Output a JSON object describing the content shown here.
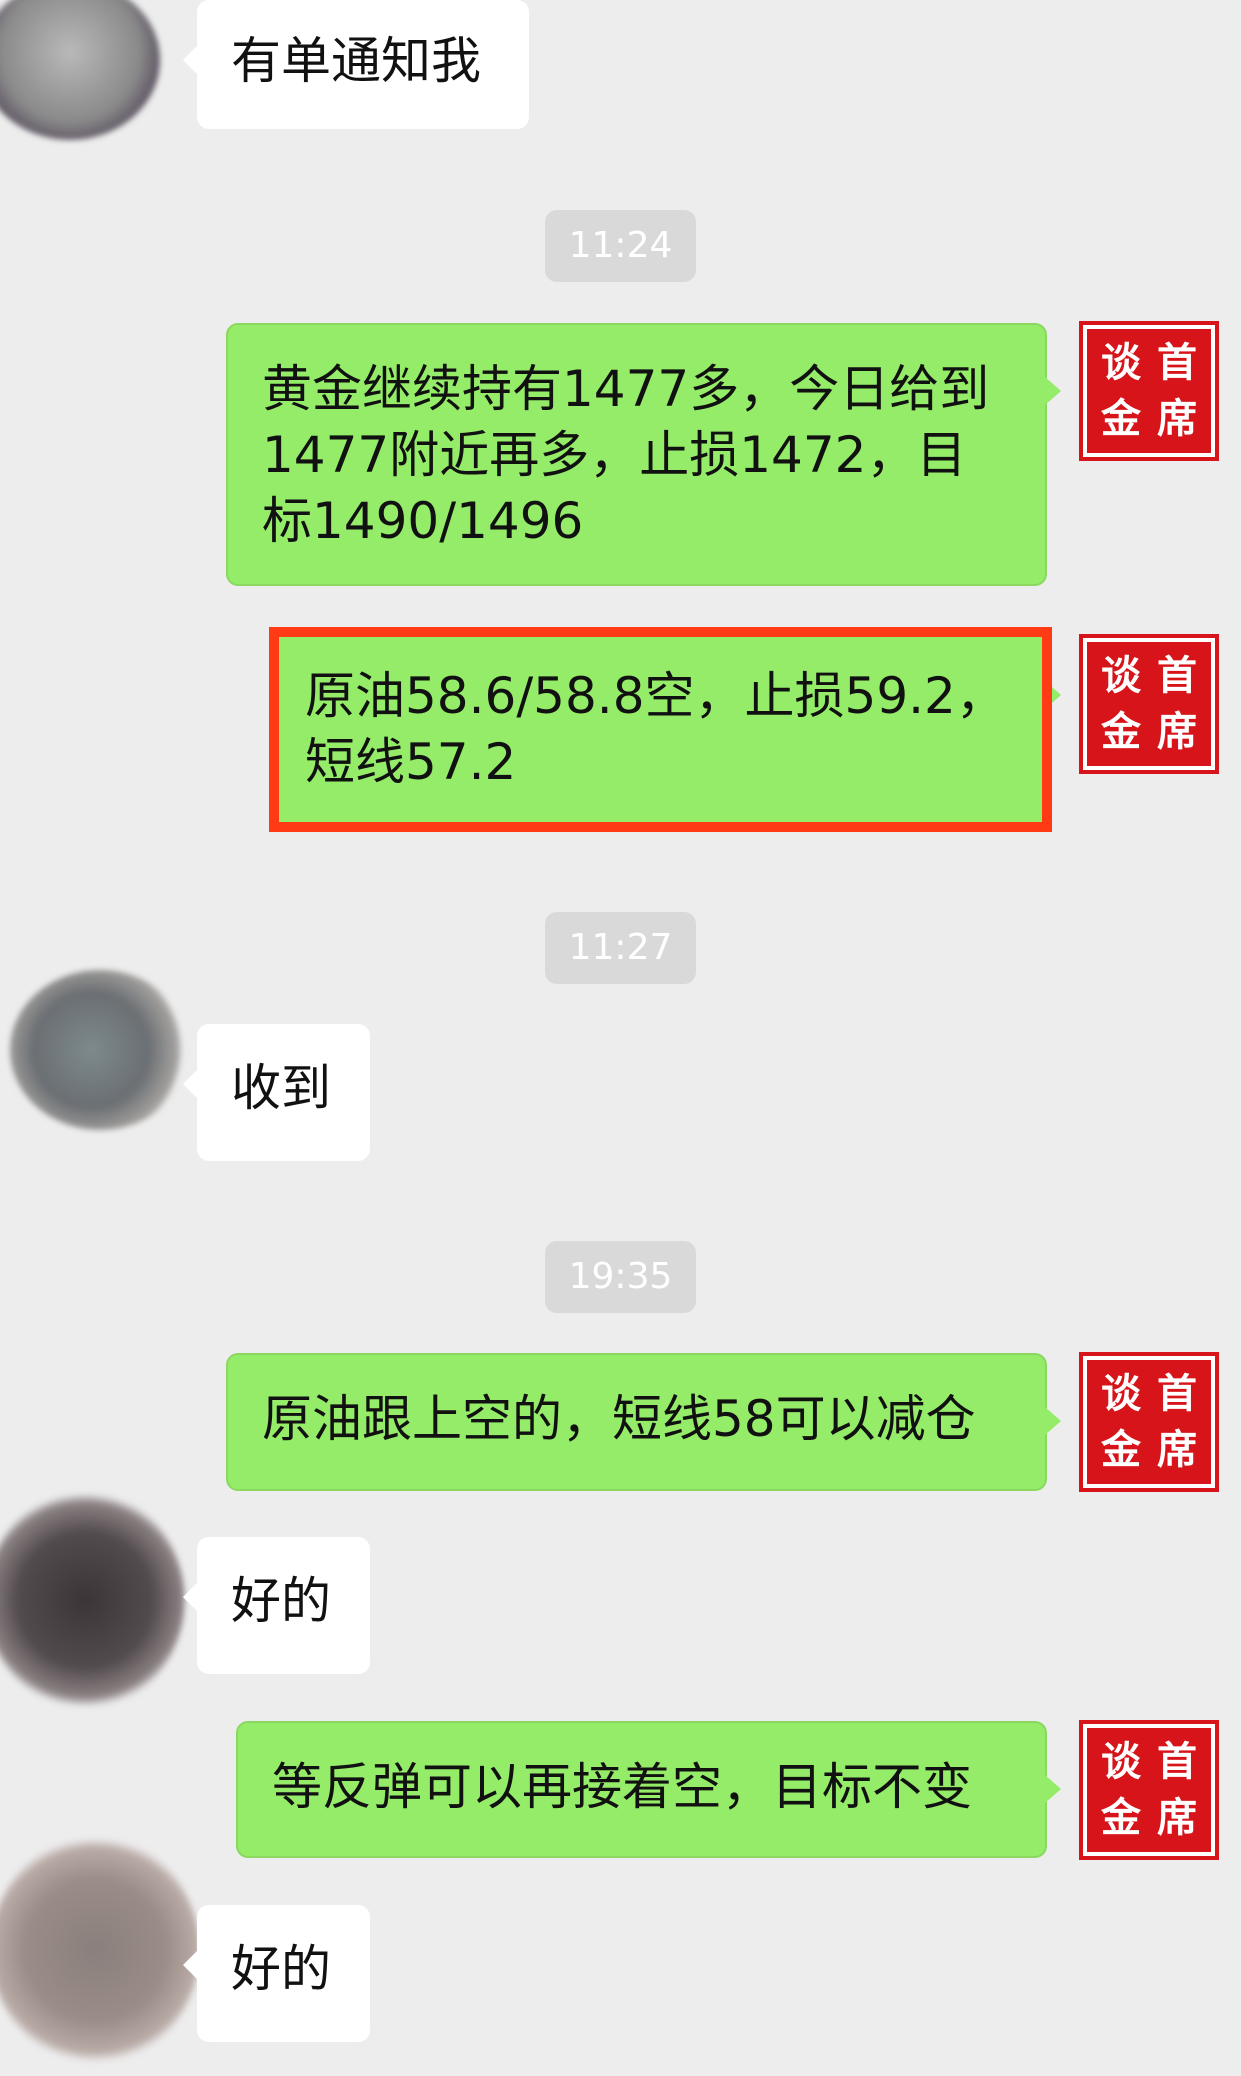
{
  "messages": [
    {
      "text": "有单通知我"
    },
    {
      "text": "11:24"
    },
    {
      "text": "黄金继续持有1477多，今日给到1477附近再多，止损1472，目标1490/1496"
    },
    {
      "text": "原油58.6/58.8空，止损59.2，短线57.2"
    },
    {
      "text": "11:27"
    },
    {
      "text": "收到"
    },
    {
      "text": "19:35"
    },
    {
      "text": "原油跟上空的，短线58可以减仓"
    },
    {
      "text": "好的"
    },
    {
      "text": "等反弹可以再接着空，目标不变"
    },
    {
      "text": "好的"
    }
  ],
  "seal_chars": [
    "谈",
    "首",
    "金",
    "席"
  ],
  "colors": {
    "background": "#ededed",
    "outgoing_bubble": "#95ec69",
    "incoming_bubble": "#ffffff",
    "timestamp_pill": "#d9d9d9",
    "highlight_border": "#ff3a14",
    "seal_red": "#d8141b"
  }
}
